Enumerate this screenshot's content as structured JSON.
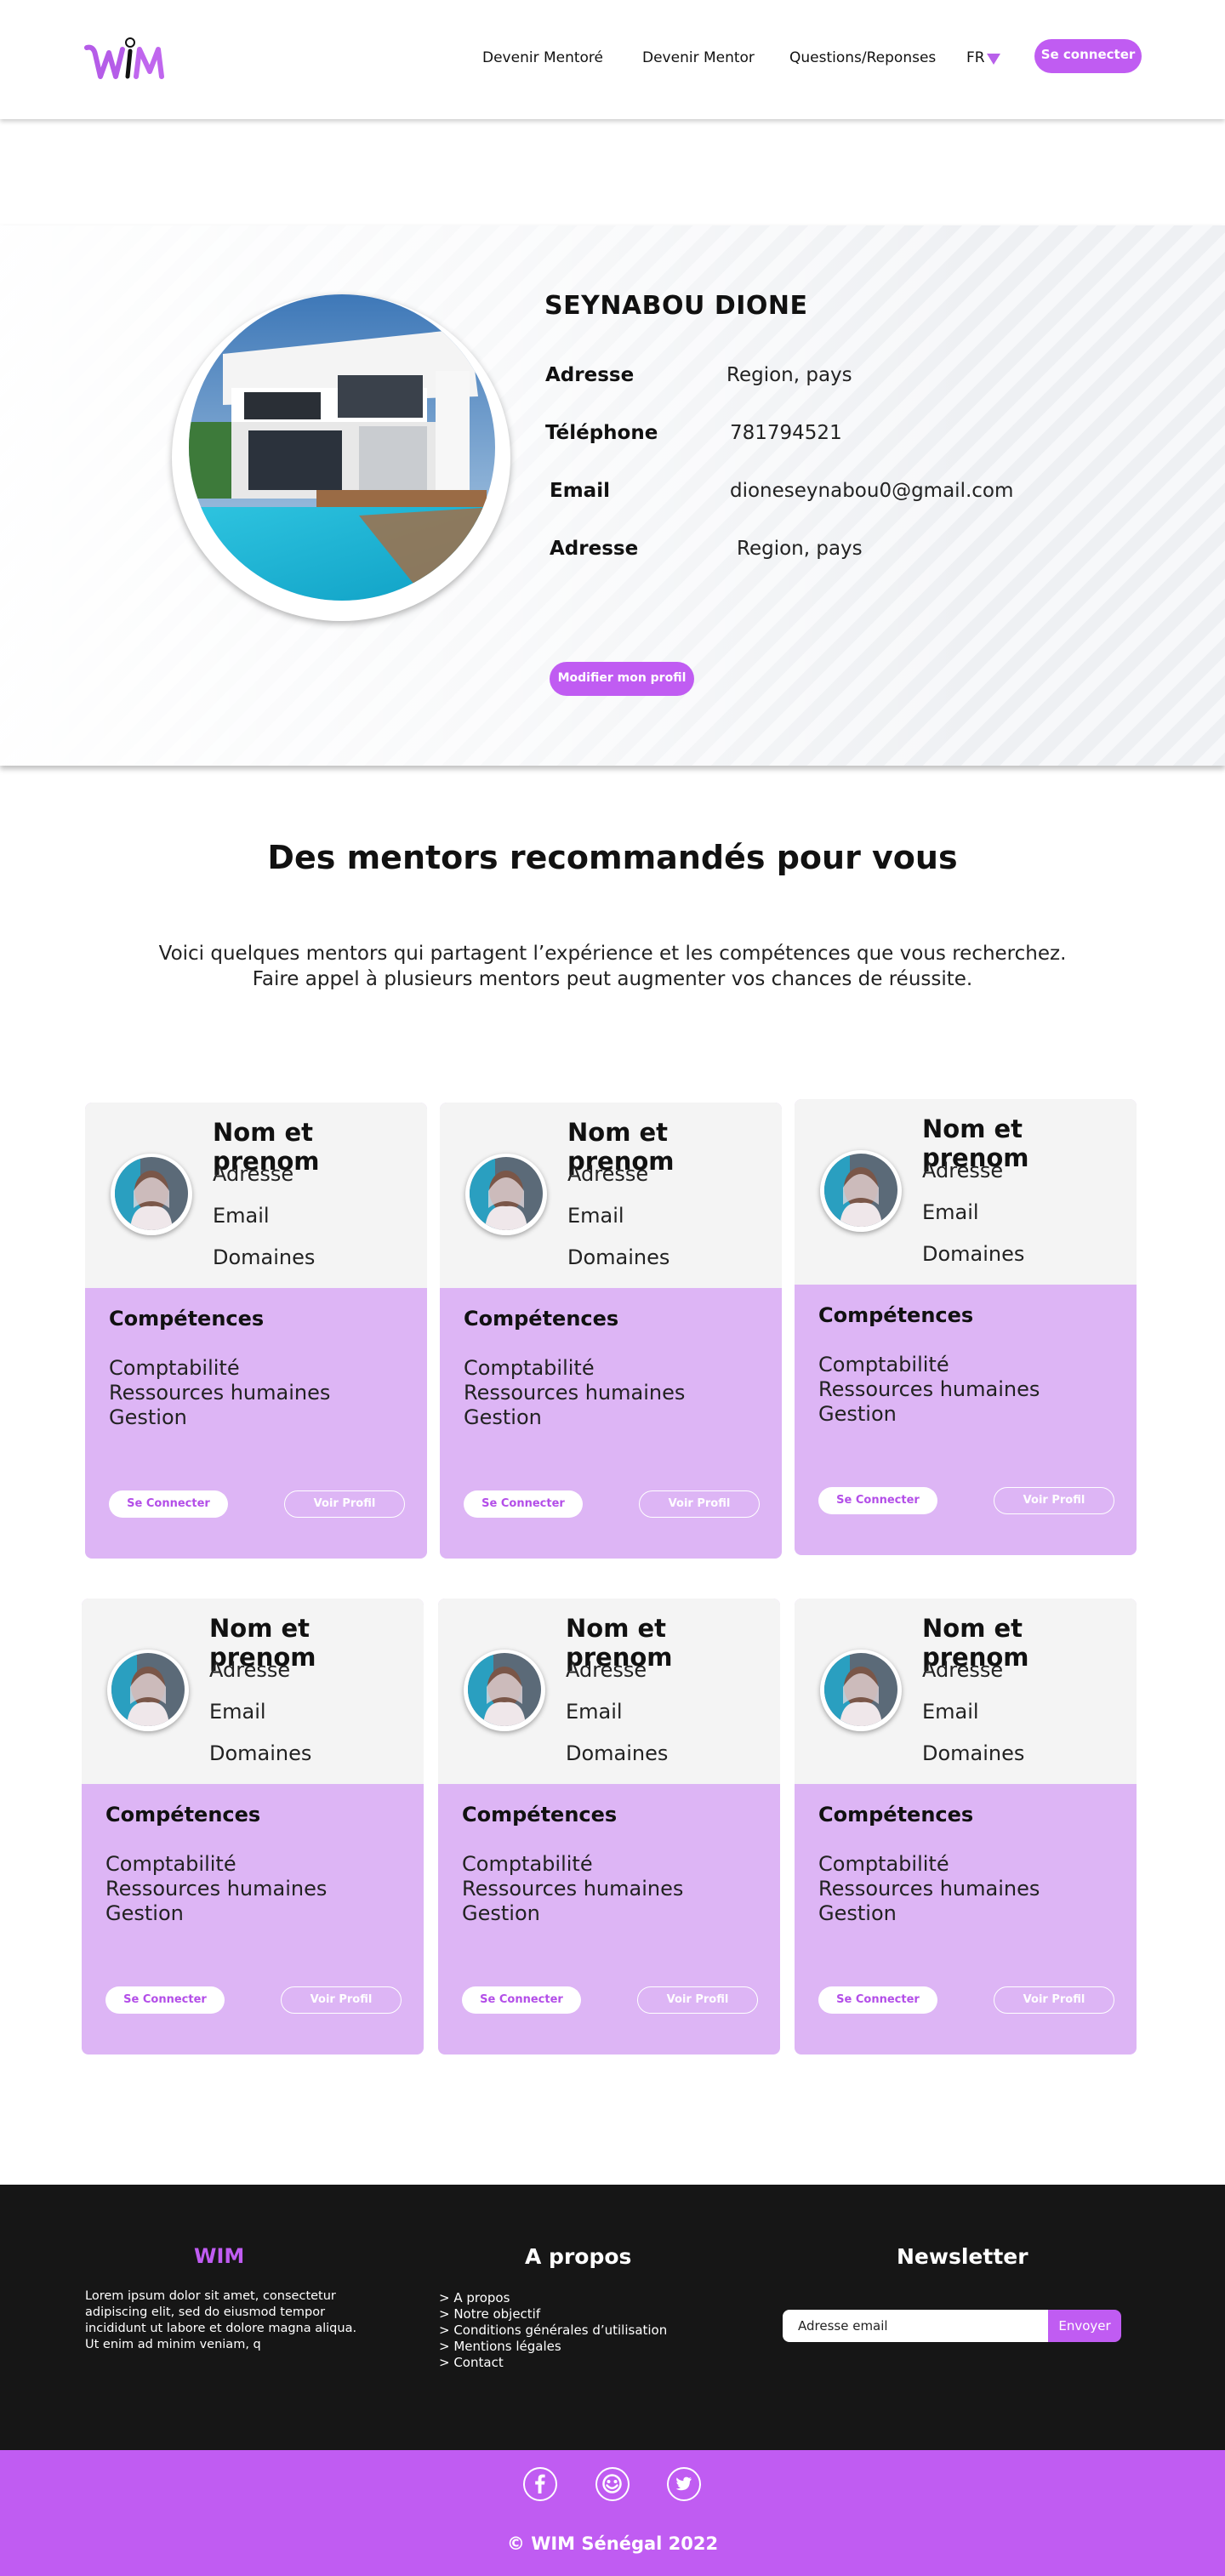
{
  "header": {
    "logo_text": "WIM",
    "nav": [
      "Devenir Mentoré",
      "Devenir Mentor",
      "Questions/Reponses"
    ],
    "lang": "FR",
    "login_label": "Se connecter"
  },
  "profile": {
    "name": "SEYNABOU DIONE",
    "fields": [
      {
        "label": "Adresse",
        "value": "Region, pays"
      },
      {
        "label": "Téléphone",
        "value": "781794521"
      },
      {
        "label": "Email",
        "value": "dioneseynabou0@gmail.com"
      },
      {
        "label": "Adresse",
        "value": "Region, pays"
      }
    ],
    "edit_label": "Modifier mon profil"
  },
  "recommended": {
    "title": "Des mentors recommandés pour vous",
    "line1": "Voici quelques mentors qui partagent l’expérience et les compétences que vous recherchez.",
    "line2": "Faire appel à plusieurs mentors peut augmenter vos chances de réussite."
  },
  "mentors": [
    {
      "name": "Nom et prenom",
      "address": "Adresse",
      "email": "Email",
      "domains": "Domaines",
      "skills_title": "Compétences",
      "skills": [
        "Comptabilité",
        "Ressources humaines",
        "Gestion"
      ],
      "connect": "Se Connecter",
      "view": "Voir Profil"
    },
    {
      "name": "Nom et prenom",
      "address": "Adresse",
      "email": "Email",
      "domains": "Domaines",
      "skills_title": "Compétences",
      "skills": [
        "Comptabilité",
        "Ressources humaines",
        "Gestion"
      ],
      "connect": "Se Connecter",
      "view": "Voir Profil"
    },
    {
      "name": "Nom et prenom",
      "address": "Adresse",
      "email": "Email",
      "domains": "Domaines",
      "skills_title": "Compétences",
      "skills": [
        "Comptabilité",
        "Ressources humaines",
        "Gestion"
      ],
      "connect": "Se Connecter",
      "view": "Voir Profil"
    },
    {
      "name": "Nom et prenom",
      "address": "Adresse",
      "email": "Email",
      "domains": "Domaines",
      "skills_title": "Compétences",
      "skills": [
        "Comptabilité",
        "Ressources humaines",
        "Gestion"
      ],
      "connect": "Se Connecter",
      "view": "Voir Profil"
    },
    {
      "name": "Nom et prenom",
      "address": "Adresse",
      "email": "Email",
      "domains": "Domaines",
      "skills_title": "Compétences",
      "skills": [
        "Comptabilité",
        "Ressources humaines",
        "Gestion"
      ],
      "connect": "Se Connecter",
      "view": "Voir Profil"
    },
    {
      "name": "Nom et prenom",
      "address": "Adresse",
      "email": "Email",
      "domains": "Domaines",
      "skills_title": "Compétences",
      "skills": [
        "Comptabilité",
        "Ressources humaines",
        "Gestion"
      ],
      "connect": "Se Connecter",
      "view": "Voir Profil"
    }
  ],
  "footer": {
    "brand": "WIM",
    "lorem": "Lorem ipsum dolor sit amet, consectetur adipiscing elit, sed do eiusmod tempor incididunt ut labore et dolore magna aliqua. Ut enim ad minim veniam, q",
    "about_title": "A propos",
    "links": [
      "> A propos",
      "> Notre objectif",
      "> Conditions générales d’utilisation",
      "> Mentions légales",
      "> Contact"
    ],
    "newsletter_title": "Newsletter",
    "email_placeholder": "Adresse email",
    "send_label": "Envoyer",
    "copyright": "© WIM Sénégal 2022"
  },
  "icons": [
    "facebook-icon",
    "snapchat-icon",
    "twitter-icon"
  ],
  "colors": {
    "accent": "#c05cf2",
    "card_purple": "#ddb5f5",
    "footer_dark": "#161616"
  }
}
